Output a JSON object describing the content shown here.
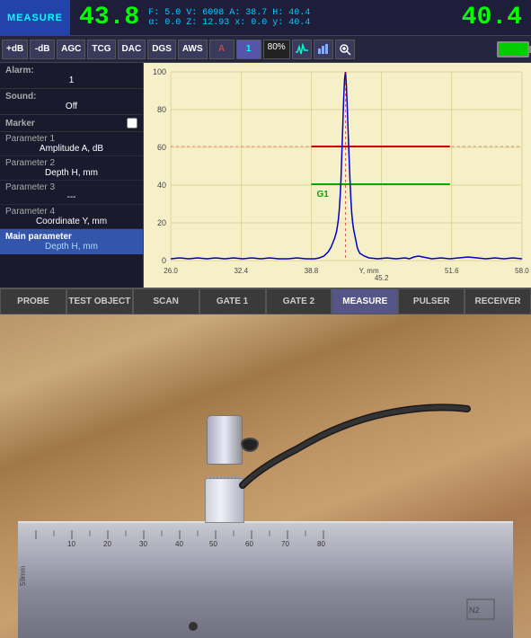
{
  "header": {
    "title": "MEASURE",
    "main_value": "43.8",
    "secondary_value": "40.4",
    "readings_row1": "F: 5.0   V: 6098   A: 38.7   H: 40.4",
    "readings_row2": "α: 0.0   Z: 12.93   x: 0.0   y: 40.4"
  },
  "toolbar": {
    "buttons": [
      "+dB",
      "-dB",
      "AGC",
      "TCG",
      "DAC",
      "DGS",
      "AWS"
    ],
    "active_buttons": [
      "1"
    ],
    "percent": "80%",
    "icons": [
      "waveform",
      "graph",
      "zoom",
      "search"
    ]
  },
  "left_panel": {
    "alarm": {
      "label": "Alarm:",
      "value": "1"
    },
    "sound": {
      "label": "Sound:",
      "value": "Off"
    },
    "marker": {
      "label": "Marker"
    },
    "parameters": [
      {
        "title": "Parameter 1",
        "value": "Amplitude A, dB"
      },
      {
        "title": "Parameter 2",
        "value": "Depth H, mm"
      },
      {
        "title": "Parameter 3",
        "value": "---"
      },
      {
        "title": "Parameter 4",
        "value": "Coordinate Y, mm"
      }
    ],
    "main_parameter": {
      "title": "Main parameter",
      "value": "Depth H, mm"
    }
  },
  "chart": {
    "y_max": "100",
    "y_labels": [
      "100",
      "80",
      "60",
      "40",
      "20",
      "0"
    ],
    "x_labels": [
      "26.0",
      "32.4",
      "38.8",
      "Y, mm 45.2",
      "51.6",
      "58.0"
    ],
    "gate1_label": "G1",
    "colors": {
      "background": "#f5f0c8",
      "grid": "#c8b870",
      "signal": "#0000cc",
      "gate_red": "#cc0000",
      "gate_green": "#00aa00"
    }
  },
  "nav_tabs": [
    {
      "label": "PROBE",
      "active": false
    },
    {
      "label": "TEST OBJECT",
      "active": false
    },
    {
      "label": "SCAN",
      "active": false
    },
    {
      "label": "GATE 1",
      "active": false
    },
    {
      "label": "GATE 2",
      "active": false
    },
    {
      "label": "MEASURE",
      "active": true
    },
    {
      "label": "PULSER",
      "active": false
    },
    {
      "label": "RECEIVER",
      "active": false
    }
  ],
  "photo": {
    "description": "Ultrasonic transducer probe on metal test block on wooden table"
  }
}
